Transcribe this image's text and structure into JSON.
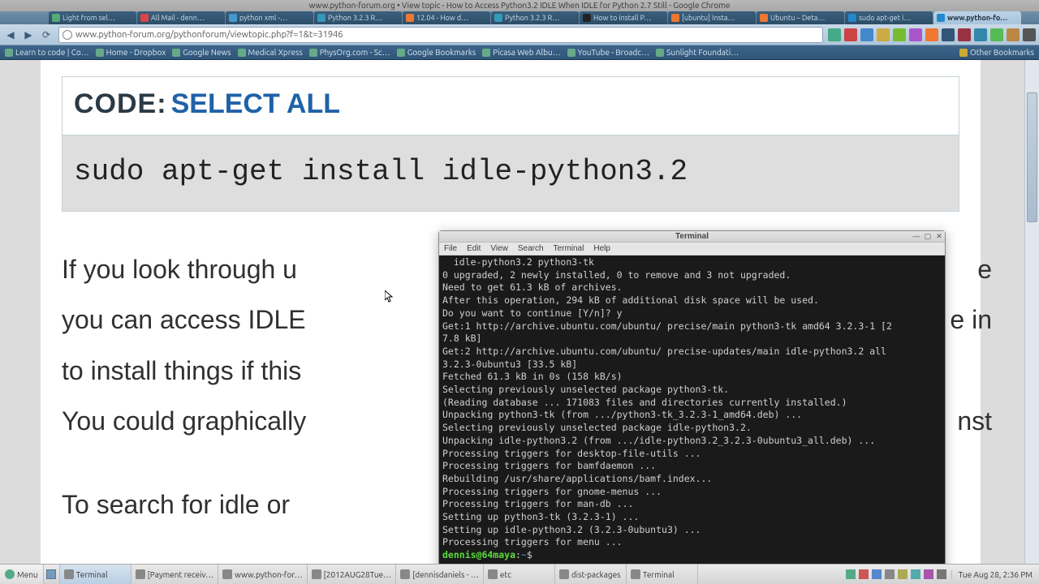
{
  "window_title": "www.python-forum.org • View topic - How to Access Python3.2 IDLE When IDLE for Python 2.7 Still - Google Chrome",
  "tabs": [
    {
      "label": "Light from sel…",
      "fav": "#5a7"
    },
    {
      "label": "All Mail - denn…",
      "fav": "#d44"
    },
    {
      "label": "python xml -…",
      "fav": "#49c"
    },
    {
      "label": "Python 3.2.3 R…",
      "fav": "#39b"
    },
    {
      "label": "12.04 - How d…",
      "fav": "#e73"
    },
    {
      "label": "Python 3.2.3 R…",
      "fav": "#39b"
    },
    {
      "label": "How to install P…",
      "fav": "#222"
    },
    {
      "label": "[ubuntu] Insta…",
      "fav": "#e73"
    },
    {
      "label": "Ubuntu – Deta…",
      "fav": "#e73"
    },
    {
      "label": "sudo apt-get i…",
      "fav": "#28c"
    },
    {
      "label": "www.python-fo…",
      "fav": "#28c",
      "active": true
    }
  ],
  "omnibox_url": "www.python-forum.org/pythonforum/viewtopic.php?f=1&t=31946",
  "bookmarks": [
    {
      "label": "Learn to code | Co…"
    },
    {
      "label": "Home - Dropbox"
    },
    {
      "label": "Google News"
    },
    {
      "label": "Medical Xpress"
    },
    {
      "label": "PhysOrg.com - Sc…"
    },
    {
      "label": "Google Bookmarks"
    },
    {
      "label": "Picasa Web Albu…"
    },
    {
      "label": "YouTube - Broadc…"
    },
    {
      "label": "Sunlight Foundati…"
    }
  ],
  "other_bookmarks": "Other Bookmarks",
  "code_label": "CODE:",
  "select_all": "SELECT ALL",
  "code_content": "sudo apt-get install idle-python3.2",
  "body_lines": [
    "If you look through u",
    "you can access IDLE",
    "to install things if this",
    "You could graphically"
  ],
  "body_suffix": [
    "e",
    "e in",
    "",
    "nst"
  ],
  "body_footer": "To search for idle or",
  "terminal": {
    "title": "Terminal",
    "menu": [
      "File",
      "Edit",
      "View",
      "Search",
      "Terminal",
      "Help"
    ],
    "lines": [
      "  idle-python3.2 python3-tk",
      "0 upgraded, 2 newly installed, 0 to remove and 3 not upgraded.",
      "Need to get 61.3 kB of archives.",
      "After this operation, 294 kB of additional disk space will be used.",
      "Do you want to continue [Y/n]? y",
      "Get:1 http://archive.ubuntu.com/ubuntu/ precise/main python3-tk amd64 3.2.3-1 [2",
      "7.8 kB]",
      "Get:2 http://archive.ubuntu.com/ubuntu/ precise-updates/main idle-python3.2 all ",
      "3.2.3-0ubuntu3 [33.5 kB]",
      "Fetched 61.3 kB in 0s (158 kB/s)",
      "Selecting previously unselected package python3-tk.",
      "(Reading database ... 171083 files and directories currently installed.)",
      "Unpacking python3-tk (from .../python3-tk_3.2.3-1_amd64.deb) ...",
      "Selecting previously unselected package idle-python3.2.",
      "Unpacking idle-python3.2 (from .../idle-python3.2_3.2.3-0ubuntu3_all.deb) ...",
      "Processing triggers for desktop-file-utils ...",
      "Processing triggers for bamfdaemon ...",
      "Rebuilding /usr/share/applications/bamf.index...",
      "Processing triggers for gnome-menus ...",
      "Processing triggers for man-db ...",
      "Setting up python3-tk (3.2.3-1) ...",
      "Setting up idle-python3.2 (3.2.3-0ubuntu3) ...",
      "Processing triggers for menu ..."
    ],
    "prompt_user": "dennis@64maya",
    "prompt_path": "~",
    "prompt_symbol": "$"
  },
  "taskbar": {
    "menu": "Menu",
    "tasks": [
      {
        "label": "Terminal",
        "active": true
      },
      {
        "label": "[Payment receiv…"
      },
      {
        "label": "www.python-for…"
      },
      {
        "label": "[2012AUG28Tue…"
      },
      {
        "label": "[dennisdaniels - …"
      },
      {
        "label": "etc"
      },
      {
        "label": "dist-packages"
      },
      {
        "label": "Terminal"
      }
    ],
    "clock": "Tue Aug 28,  2:36 PM"
  }
}
